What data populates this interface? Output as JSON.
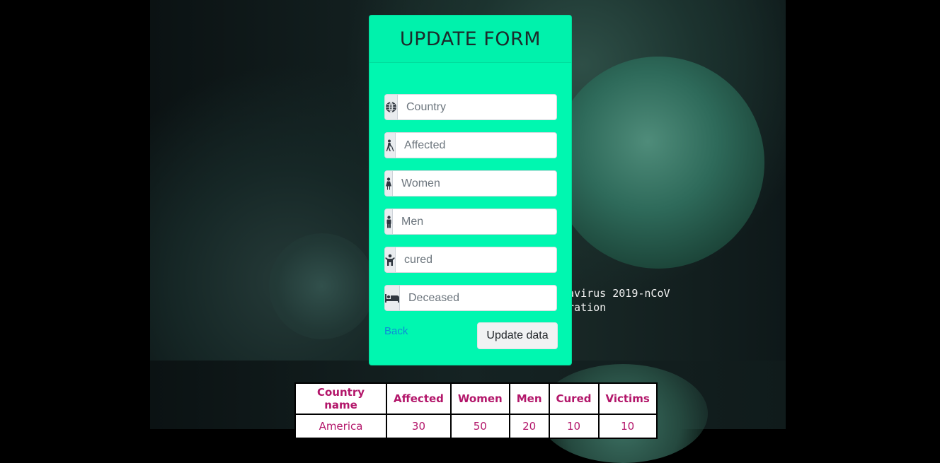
{
  "form": {
    "title": "UPDATE FORM",
    "fields": [
      {
        "icon": "globe-icon",
        "placeholder": "Country"
      },
      {
        "icon": "person-cane-icon",
        "placeholder": "Affected"
      },
      {
        "icon": "female-icon",
        "placeholder": "Women"
      },
      {
        "icon": "male-icon",
        "placeholder": "Men"
      },
      {
        "icon": "child-icon",
        "placeholder": "cured"
      },
      {
        "icon": "bed-icon",
        "placeholder": "Deceased"
      }
    ],
    "back_label": "Back",
    "submit_label": "Update data"
  },
  "background": {
    "caption_line1": "navirus 2019-nCoV",
    "caption_line2": "tration"
  },
  "table": {
    "headers": [
      "Country name",
      "Affected",
      "Women",
      "Men",
      "Cured",
      "Victims"
    ],
    "rows": [
      [
        "America",
        "30",
        "50",
        "20",
        "10",
        "10"
      ]
    ]
  },
  "colors": {
    "card": "#00f7b0",
    "header_text": "#b3166a",
    "link": "#0d8bd8"
  }
}
